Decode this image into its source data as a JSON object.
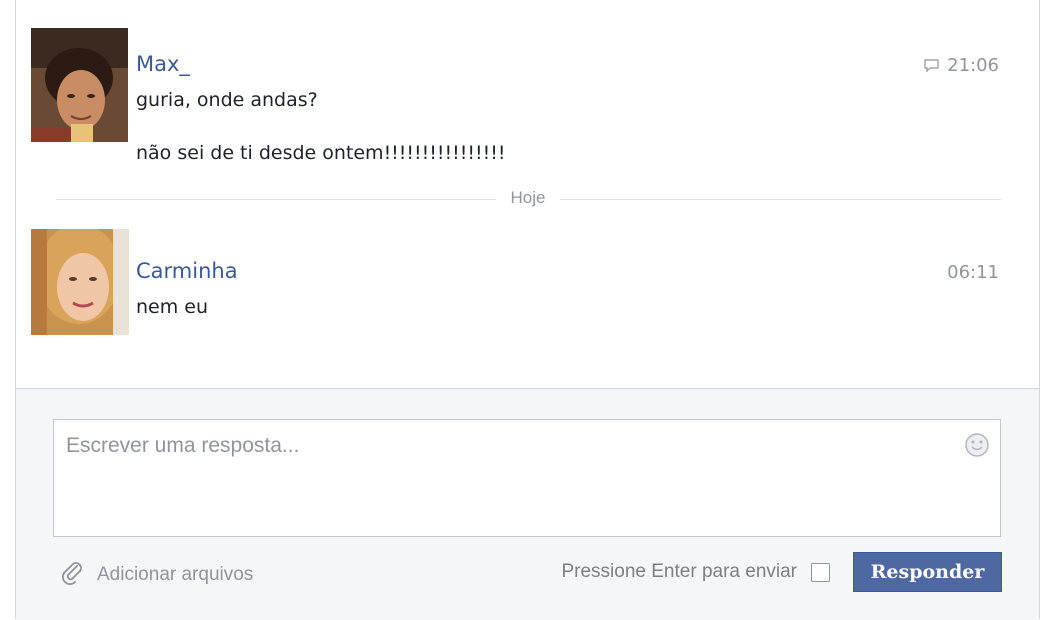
{
  "messages": [
    {
      "author": "Max_",
      "time": "21:06",
      "lines": [
        "guria, onde andas?",
        "não sei de ti desde ontem!!!!!!!!!!!!!!!!"
      ],
      "has_reply_icon": true
    },
    {
      "author": "Carminha",
      "time": "06:11",
      "lines": [
        "nem eu"
      ],
      "has_reply_icon": false
    }
  ],
  "divider": {
    "label": "Hoje"
  },
  "composer": {
    "placeholder": "Escrever uma resposta...",
    "attach_label": "Adicionar arquivos",
    "enter_hint": "Pressione Enter para enviar",
    "reply_button": "Responder"
  },
  "icons": {
    "reply_bubble": "speech-bubble-icon",
    "emoji": "smiley-icon",
    "attach": "paperclip-icon"
  },
  "colors": {
    "link": "#3b5998",
    "button": "#4e69a2",
    "muted": "#90949c",
    "composer_bg": "#f5f6f7"
  }
}
